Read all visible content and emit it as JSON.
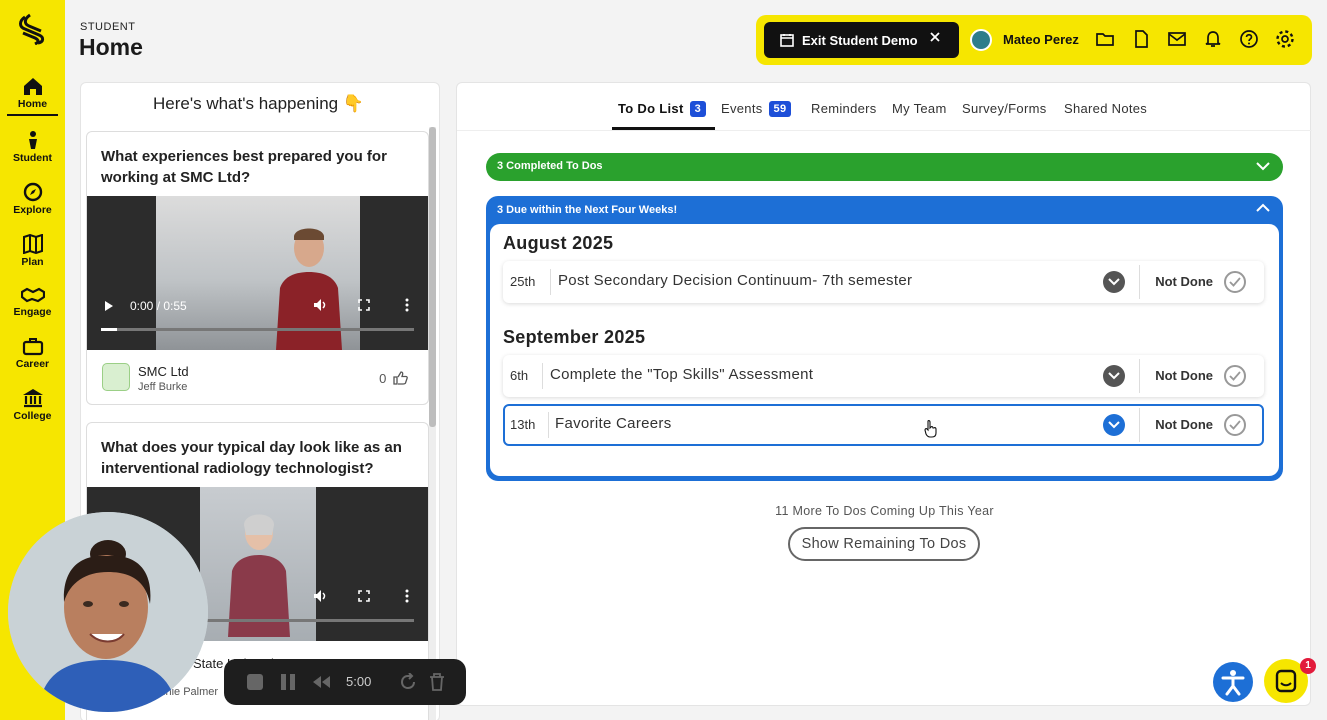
{
  "sidebar": {
    "items": [
      {
        "label": "Home",
        "icon": "home-icon",
        "active": true
      },
      {
        "label": "Student",
        "icon": "student-icon"
      },
      {
        "label": "Explore",
        "icon": "compass-icon"
      },
      {
        "label": "Plan",
        "icon": "map-icon"
      },
      {
        "label": "Engage",
        "icon": "handshake-icon"
      },
      {
        "label": "Career",
        "icon": "briefcase-icon"
      },
      {
        "label": "College",
        "icon": "college-icon"
      }
    ]
  },
  "header": {
    "subtitle": "STUDENT",
    "title": "Home"
  },
  "topbar": {
    "exit_label": "Exit Student Demo",
    "user_name": "Mateo Perez",
    "icons": [
      "folder-icon",
      "document-icon",
      "mail-icon",
      "bell-icon",
      "help-icon",
      "settings-icon"
    ]
  },
  "feed": {
    "title": "Here's what's happening 👇",
    "cards": [
      {
        "question": "What experiences best prepared you for working at SMC Ltd?",
        "video_time": "0:00 / 0:55",
        "company": "SMC Ltd",
        "person": "Jeff Burke",
        "likes": "0"
      },
      {
        "question": "What does your typical day look like as an interventional radiology technologist?",
        "company": "State University Wexner Center",
        "person": "Annie Palmer"
      }
    ]
  },
  "tabs": [
    {
      "label": "To Do List",
      "badge": "3",
      "active": true
    },
    {
      "label": "Events",
      "badge": "59"
    },
    {
      "label": "Reminders"
    },
    {
      "label": "My Team"
    },
    {
      "label": "Survey/Forms"
    },
    {
      "label": "Shared Notes"
    }
  ],
  "todo": {
    "completed_label": "3 Completed To Dos",
    "due_label": "3 Due within the Next Four Weeks!",
    "months": [
      {
        "name": "August 2025",
        "tasks": [
          {
            "day": "25th",
            "name": "Post Secondary Decision Continuum- 7th semester",
            "status": "Not Done"
          }
        ]
      },
      {
        "name": "September 2025",
        "tasks": [
          {
            "day": "6th",
            "name": "Complete the \"Top Skills\" Assessment",
            "status": "Not Done"
          },
          {
            "day": "13th",
            "name": "Favorite Careers",
            "status": "Not Done"
          }
        ]
      }
    ],
    "more_text": "11 More To Dos Coming Up This Year",
    "show_remaining_label": "Show Remaining To Dos"
  },
  "recorder": {
    "time": "5:00"
  },
  "chat": {
    "badge": "1"
  },
  "colors": {
    "brand_yellow": "#f6e600",
    "green": "#2aa12d",
    "blue": "#1d6fd6",
    "badge_blue": "#1d4fd8"
  }
}
